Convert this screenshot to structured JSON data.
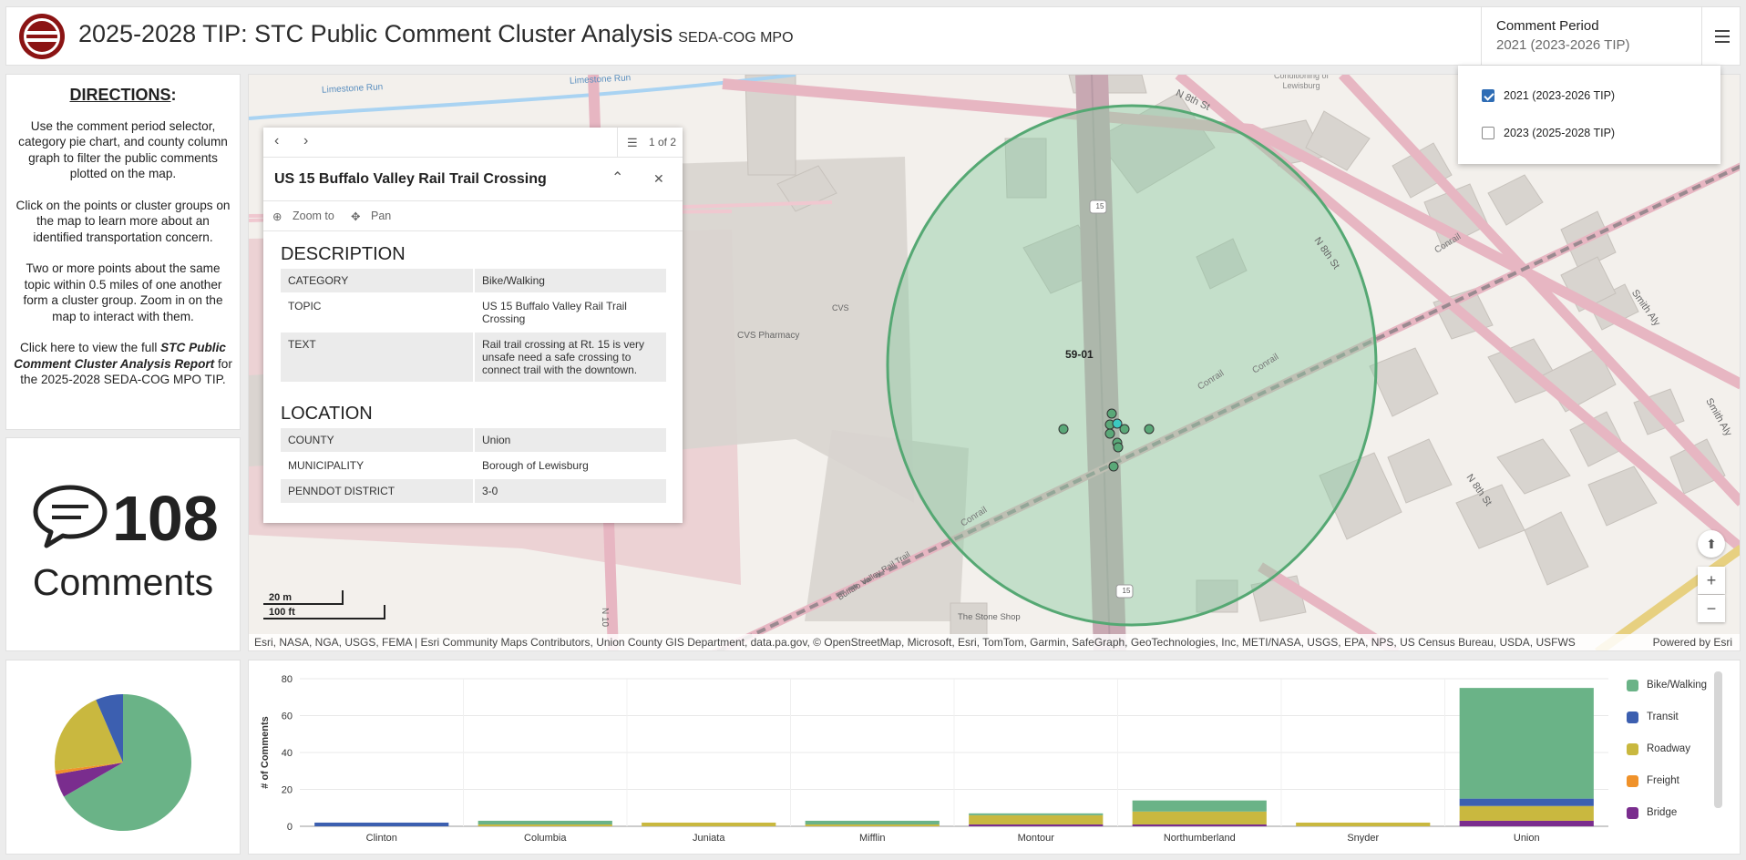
{
  "header": {
    "title": "2025-2028 TIP: STC Public Comment Cluster Analysis",
    "subtitle": "SEDA-COG MPO",
    "period_label": "Comment Period",
    "period_value": "2021 (2023-2026 TIP)"
  },
  "period_options": [
    {
      "label": "2021 (2023-2026 TIP)",
      "checked": true
    },
    {
      "label": "2023 (2025-2028 TIP)",
      "checked": false
    }
  ],
  "directions": {
    "heading": "DIRECTIONS",
    "heading_colon": ":",
    "p1": "Use the comment period selector, category pie chart, and county column graph to filter the public comments plotted on the map.",
    "p2": "Click on the points or cluster groups on the map to learn more about an identified transportation concern.",
    "p3": "Two or more points about the same topic within 0.5 miles of one another form a cluster group. Zoom in on the map to interact with them.",
    "p4_pre": "Click here to view the full ",
    "p4_link": "STC Public Comment Cluster Analysis Report",
    "p4_post": " for the 2025-2028 SEDA-COG MPO TIP."
  },
  "counter": {
    "value": "108",
    "label": "Comments",
    "icon": "chat-bubble-icon"
  },
  "popup": {
    "pager": "1 of 2",
    "title": "US 15 Buffalo Valley Rail Trail Crossing",
    "zoom_label": "Zoom to",
    "pan_label": "Pan",
    "description_heading": "DESCRIPTION",
    "description": [
      {
        "key": "CATEGORY",
        "value": "Bike/Walking"
      },
      {
        "key": "TOPIC",
        "value": "US 15 Buffalo Valley Rail Trail Crossing"
      },
      {
        "key": "TEXT",
        "value": "Rail trail crossing at Rt. 15 is very unsafe need a safe crossing to connect trail with the downtown."
      }
    ],
    "location_heading": "LOCATION",
    "location": [
      {
        "key": "COUNTY",
        "value": "Union"
      },
      {
        "key": "MUNICIPALITY",
        "value": "Borough of Lewisburg"
      },
      {
        "key": "PENNDOT DISTRICT",
        "value": "3-0"
      }
    ]
  },
  "map": {
    "cluster_label": "59-01",
    "labels": {
      "limestone1": "Limestone Run",
      "limestone2": "Limestone Run",
      "n8th_top": "N 8th St",
      "n8th_mid": "N 8th St",
      "n8th_low": "N 8th St",
      "conrail1": "Conrail",
      "conrail2": "Conrail",
      "conrail3": "Conrail",
      "conrail4": "Conrail",
      "smith": "Smith Aly",
      "smith2": "Smith Aly",
      "cvs": "CVS",
      "cvs_pharmacy": "CVS Pharmacy",
      "rail_trail": "Buffalo Valley Rail Trail",
      "stone_shop": "The Stone Shop",
      "n10": "N 10",
      "conditioning": "Conditioning of Lewisburg",
      "route15": "15"
    },
    "scale_m": "20 m",
    "scale_ft": "100 ft",
    "attribution": "Esri, NASA, NGA, USGS, FEMA | Esri Community Maps Contributors, Union County GIS Department, data.pa.gov, © OpenStreetMap, Microsoft, Esri, TomTom, Garmin, SafeGraph, GeoTechnologies, Inc, METI/NASA, USGS, EPA, NPS, US Census Bureau, USDA, USFWS",
    "powered": "Powered by Esri",
    "zoom_in": "+",
    "zoom_out": "−"
  },
  "colors": {
    "bike": "#6ab387",
    "transit": "#3c5fb0",
    "roadway": "#c9b83f",
    "freight": "#f0922a",
    "bridge": "#7a2d8e"
  },
  "pie_data": {
    "type": "pie",
    "slices": [
      {
        "name": "Bike/Walking",
        "value": 72
      },
      {
        "name": "Bridge",
        "value": 6
      },
      {
        "name": "Freight",
        "value": 1
      },
      {
        "name": "Roadway",
        "value": 22
      },
      {
        "name": "Transit",
        "value": 7
      }
    ]
  },
  "chart_data": {
    "type": "bar",
    "ylabel": "# of Comments",
    "ylim": [
      0,
      80
    ],
    "yticks": [
      0,
      20,
      40,
      60,
      80
    ],
    "categories": [
      "Clinton",
      "Columbia",
      "Juniata",
      "Mifflin",
      "Montour",
      "Northumberland",
      "Snyder",
      "Union"
    ],
    "series": [
      {
        "name": "Bridge",
        "values": [
          0,
          0,
          0,
          0,
          1,
          1,
          0,
          3
        ]
      },
      {
        "name": "Freight",
        "values": [
          0,
          0,
          0,
          0,
          0,
          0,
          0,
          0
        ]
      },
      {
        "name": "Roadway",
        "values": [
          0,
          1,
          2,
          1,
          5,
          7,
          2,
          8
        ]
      },
      {
        "name": "Transit",
        "values": [
          2,
          0,
          0,
          0,
          0,
          0,
          0,
          4
        ]
      },
      {
        "name": "Bike/Walking",
        "values": [
          0,
          2,
          0,
          2,
          1,
          6,
          0,
          60
        ]
      }
    ],
    "legend": [
      "Bike/Walking",
      "Transit",
      "Roadway",
      "Freight",
      "Bridge"
    ],
    "legend_position": "right"
  }
}
